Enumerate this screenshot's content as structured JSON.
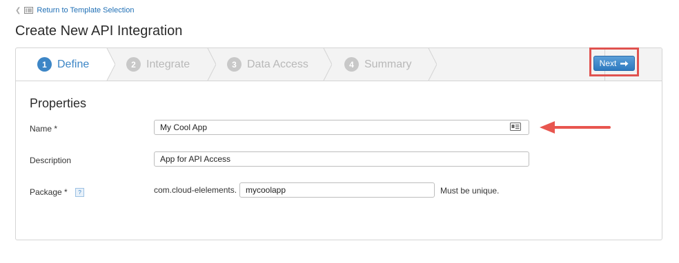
{
  "nav": {
    "back_label": "Return to Template Selection"
  },
  "page": {
    "title": "Create New API Integration"
  },
  "wizard": {
    "steps": [
      {
        "number": "1",
        "label": "Define",
        "active": true
      },
      {
        "number": "2",
        "label": "Integrate",
        "active": false
      },
      {
        "number": "3",
        "label": "Data Access",
        "active": false
      },
      {
        "number": "4",
        "label": "Summary",
        "active": false
      }
    ],
    "next_label": "Next"
  },
  "form": {
    "section_title": "Properties",
    "name": {
      "label": "Name *",
      "value": "My Cool App"
    },
    "description": {
      "label": "Description",
      "value": "App for API Access"
    },
    "package": {
      "label": "Package *",
      "help": "?",
      "prefix": "com.cloud-elelements.",
      "value": "mycoolapp",
      "hint": "Must be unique."
    }
  },
  "colors": {
    "accent": "#3d86c6",
    "highlight": "#e0524f",
    "arrow": "#e8564f"
  },
  "icons": [
    "chevron-left-icon",
    "list-icon",
    "arrow-right-icon",
    "contact-card-icon",
    "question-icon"
  ]
}
